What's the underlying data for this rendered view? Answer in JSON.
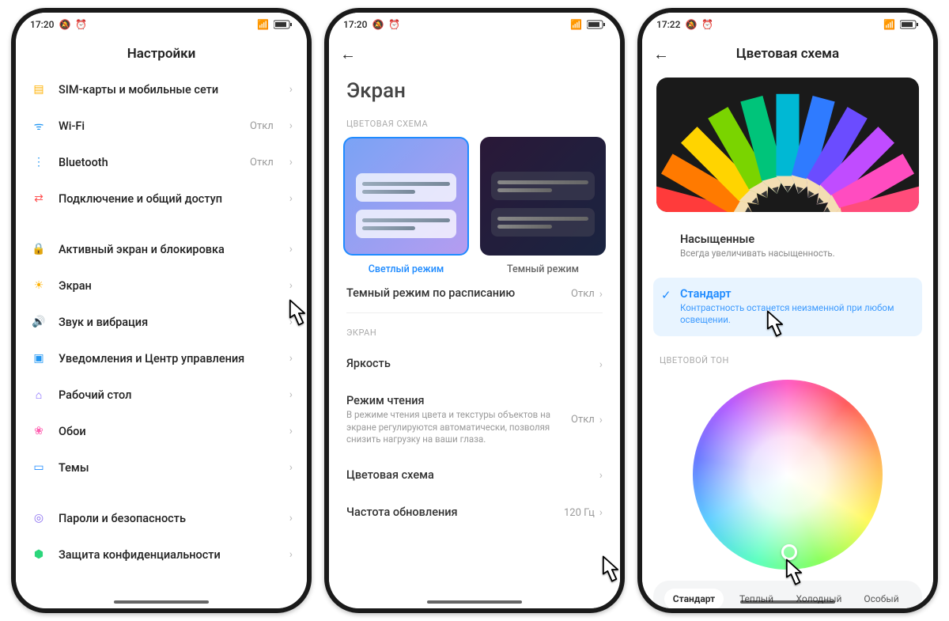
{
  "status": {
    "time1": "17:20",
    "time2": "17:20",
    "time3": "17:22",
    "muteIcon": "🔕",
    "alarmIcon": "⏰",
    "signal": "📶",
    "battPct": 80
  },
  "screen1": {
    "title": "Настройки",
    "items": [
      {
        "label": "SIM-карты и мобильные сети",
        "value": "",
        "icon": "sim",
        "color": "#ffb100"
      },
      {
        "label": "Wi-Fi",
        "value": "Откл",
        "icon": "wifi",
        "color": "#2196f3"
      },
      {
        "label": "Bluetooth",
        "value": "Откл",
        "icon": "bt",
        "color": "#2196f3"
      },
      {
        "label": "Подключение и общий доступ",
        "value": "",
        "icon": "share",
        "color": "#ff5252"
      }
    ],
    "items2": [
      {
        "label": "Активный экран и блокировка",
        "icon": "lock",
        "color": "#ff5252"
      },
      {
        "label": "Экран",
        "icon": "sun",
        "color": "#ffb100"
      },
      {
        "label": "Звук и вибрация",
        "icon": "sound",
        "color": "#2bd67b"
      },
      {
        "label": "Уведомления и Центр управления",
        "icon": "notif",
        "color": "#2196f3"
      },
      {
        "label": "Рабочий стол",
        "icon": "home",
        "color": "#7a5cff"
      },
      {
        "label": "Обои",
        "icon": "flower",
        "color": "#ff5eb0"
      },
      {
        "label": "Темы",
        "icon": "theme",
        "color": "#1f8bff"
      }
    ],
    "items3": [
      {
        "label": "Пароли и безопасность",
        "icon": "pw",
        "color": "#8a6df0"
      },
      {
        "label": "Защита конфиденциальности",
        "icon": "priv",
        "color": "#2bd67b"
      }
    ]
  },
  "screen2": {
    "title": "Экран",
    "sectionScheme": "ЦВЕТОВАЯ СХЕМА",
    "lightLabel": "Светлый режим",
    "darkLabel": "Темный режим",
    "scheduleLabel": "Темный режим по расписанию",
    "scheduleVal": "Откл",
    "sectionScreen": "ЭКРАН",
    "brightness": "Яркость",
    "readMode": "Режим чтения",
    "readModeDesc": "В режиме чтения цвета и текстуры объектов на экране регулируются автоматически, позволяя снизить нагрузку на ваши глаза.",
    "readModeVal": "Откл",
    "colorScheme": "Цветовая схема",
    "refresh": "Частота обновления",
    "refreshVal": "120 Гц"
  },
  "screen3": {
    "title": "Цветовая схема",
    "opt1": "Насыщенные",
    "opt1desc": "Всегда увеличивать насыщенность.",
    "opt2": "Стандарт",
    "opt2desc": "Контрастность останется неизменной при любом освещении.",
    "sectionTone": "ЦВЕТОВОЙ ТОН",
    "tabs": [
      "Стандарт",
      "Теплый",
      "Холодный",
      "Особый"
    ]
  }
}
